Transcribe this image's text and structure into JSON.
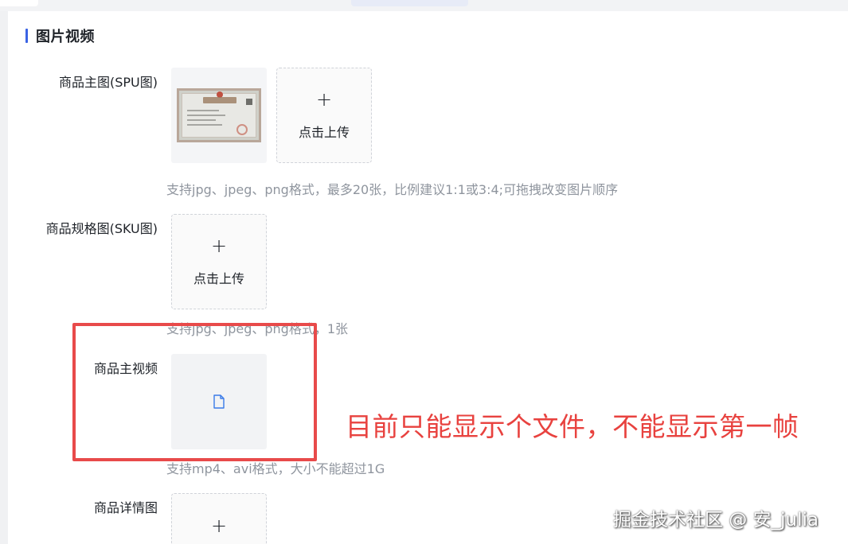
{
  "section": {
    "title": "图片视频"
  },
  "spu": {
    "label": "商品主图(SPU图)",
    "upload_icon": "plus-icon",
    "upload_text": "点击上传",
    "hint": "支持jpg、jpeg、png格式，最多20张，比例建议1:1或3:4;可拖拽改变图片顺序"
  },
  "sku": {
    "label": "商品规格图(SKU图)",
    "upload_icon": "plus-icon",
    "upload_text": "点击上传",
    "hint": "支持jpg、jpeg、png格式，1张"
  },
  "video": {
    "label": "商品主视频",
    "file_icon": "file-icon",
    "hint": "支持mp4、avi格式，大小不能超过1G"
  },
  "detail": {
    "label": "商品详情图",
    "upload_icon": "plus-icon"
  },
  "annotation": {
    "text": "目前只能显示个文件，不能显示第一帧",
    "color": "#e8423f"
  },
  "watermark": "掘金技术社区 @ 安_julia",
  "colors": {
    "accent": "#3a63e4",
    "hint": "#8f959e"
  }
}
